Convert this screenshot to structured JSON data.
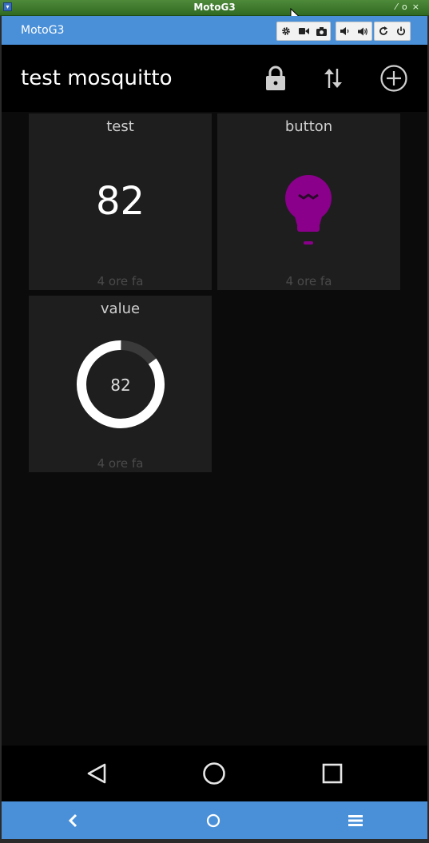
{
  "window": {
    "title": "MotoG3"
  },
  "emulator": {
    "device_name": "MotoG3",
    "toolbar_icons": [
      "gear-icon",
      "video-camera-icon",
      "camera-icon",
      "volume-down-icon",
      "volume-up-icon",
      "rotate-icon",
      "power-icon"
    ]
  },
  "app": {
    "title": "test mosquitto",
    "actions": [
      "lock-icon",
      "sort-arrows-icon",
      "add-circle-icon"
    ]
  },
  "tiles": [
    {
      "title": "test",
      "value": "82",
      "footer": "4 ore fa"
    },
    {
      "title": "button",
      "icon": "lightbulb-icon",
      "icon_color": "#8a008a",
      "footer": "4 ore fa"
    },
    {
      "title": "value",
      "value": "82",
      "gauge_fraction": 0.85,
      "footer": "4 ore fa"
    }
  ],
  "colors": {
    "accent": "#4a90d9",
    "tile_bg": "#1e1e1f",
    "bulb": "#8a008a"
  },
  "nav": [
    "back-triangle-icon",
    "home-circle-icon",
    "recents-square-icon"
  ],
  "emulator_nav": [
    "chevron-left-icon",
    "home-icon",
    "menu-icon"
  ]
}
